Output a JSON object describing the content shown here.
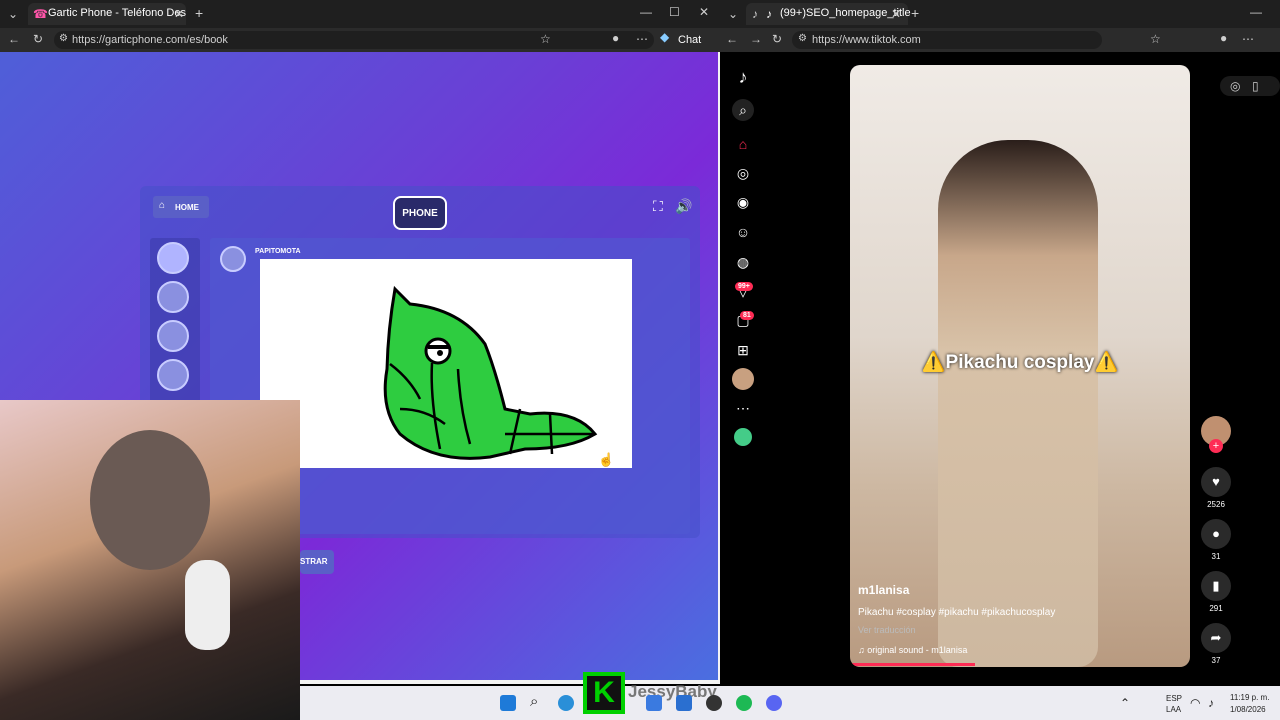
{
  "left_browser": {
    "tab_title": "Gartic Phone - Teléfono Descomp",
    "url": "https://garticphone.com/es/book",
    "chat_label": "Chat"
  },
  "gartic": {
    "home_label": "HOME",
    "logo_text": "PHONE",
    "player_name": "PAPITOMOTA",
    "show_button_label": "STRAR"
  },
  "right_browser": {
    "tab_title": "(99+)SEO_homepage_title",
    "url": "https://www.tiktok.com"
  },
  "tiktok": {
    "badges": {
      "inbox": "99+",
      "messages": "81"
    },
    "caption": "⚠️Pikachu cosplay⚠️",
    "username": "m1lanisa",
    "description": "Pikachu #cosplay #pikachu #pikachucosplay",
    "translation": "Ver traducción",
    "sound": "original sound - m1lanisa",
    "likes": "2526",
    "comments": "31",
    "saves": "291",
    "shares": "37"
  },
  "taskbar": {
    "overlay_name": "JessyBaby",
    "lang": "ESP",
    "lang_sub": "LAA",
    "time": "11:19 p. m.",
    "date": "1/08/2026"
  },
  "colors": {
    "tiktok_red": "#fe2c55",
    "drawing_green": "#2ecc40"
  }
}
